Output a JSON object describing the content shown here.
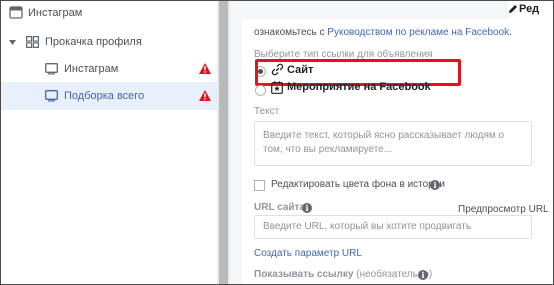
{
  "left_panel": {
    "items": [
      {
        "label": "Инстаграм",
        "level": 0,
        "icon": "folder-icon"
      },
      {
        "label": "Прокачка профиля",
        "level": 0,
        "icon": "adset-grid-icon",
        "expanded": true
      },
      {
        "label": "Инстаграм",
        "level": 1,
        "icon": "monitor-icon",
        "warning": true
      },
      {
        "label": "Подборка всего",
        "level": 1,
        "icon": "monitor-icon",
        "warning": true,
        "selected": true
      }
    ]
  },
  "tab": {
    "label": "Ред"
  },
  "form": {
    "intro_prefix": "ознакомьтесь с ",
    "intro_link": "Руководством по рекламе на Facebook",
    "intro_suffix": ".",
    "link_type_label": "Выберите тип ссылки для объявления",
    "options": [
      {
        "label": "Сайт",
        "checked": true,
        "icon": "link-icon"
      },
      {
        "label": "Мероприятие на Facebook",
        "checked": false,
        "icon": "event-star-icon"
      }
    ],
    "text_label": "Текст",
    "text_placeholder": "Введите текст, который ясно рассказывает людям о том, что вы рекламируете...",
    "story_bg_label": "Редактировать цвета фона в истории",
    "url_label": "URL сайта",
    "url_preview": "Предпросмотр URL",
    "url_placeholder": "Введите URL, который вы хотите продвигать",
    "url_param_link": "Создать параметр URL",
    "show_link_label": "Показывать ссылку",
    "show_link_optional": "(необязательно)",
    "info_glyph": "i"
  },
  "colors": {
    "accent": "#4267b2",
    "highlight": "#e0141e",
    "warning": "#e0141e",
    "selected_bg": "#e7f0fb"
  }
}
